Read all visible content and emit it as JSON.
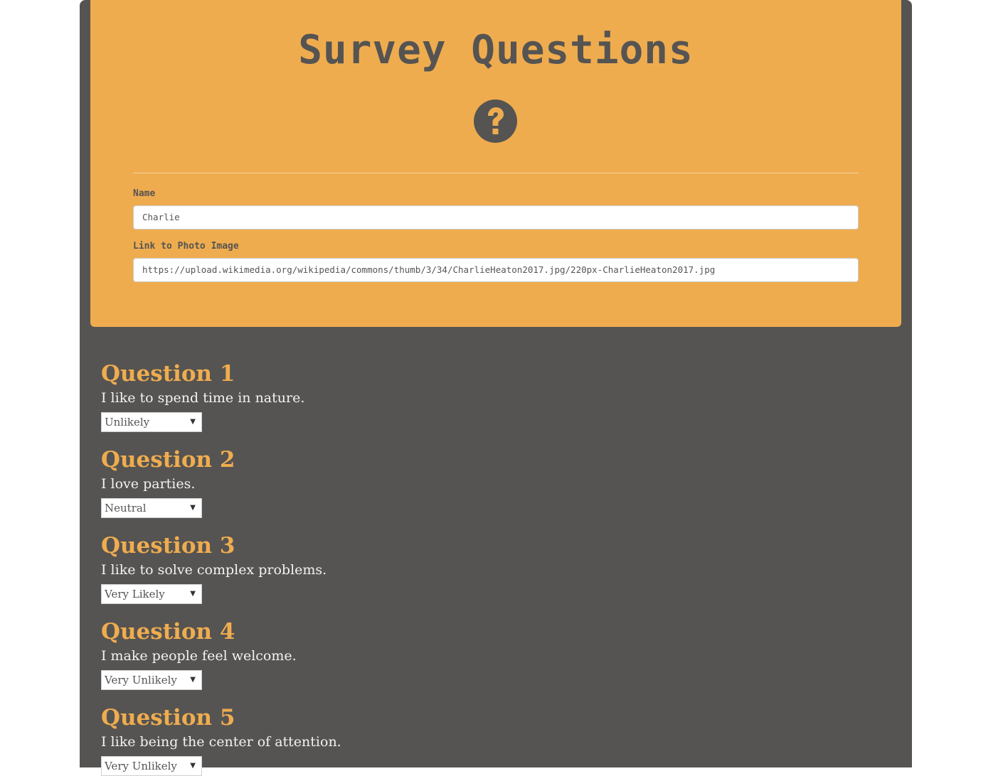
{
  "header": {
    "title": "Survey Questions",
    "icon": "question-circle-icon",
    "accent_color": "#efac4f",
    "dark_color": "#555452"
  },
  "form": {
    "name_label": "Name",
    "name_value": "Charlie",
    "photo_label": "Link to Photo Image",
    "photo_value": "https://upload.wikimedia.org/wikipedia/commons/thumb/3/34/CharlieHeaton2017.jpg/220px-CharlieHeaton2017.jpg"
  },
  "questions": [
    {
      "title": "Question 1",
      "text": "I like to spend time in nature.",
      "answer": "Unlikely"
    },
    {
      "title": "Question 2",
      "text": "I love parties.",
      "answer": "Neutral"
    },
    {
      "title": "Question 3",
      "text": "I like to solve complex problems.",
      "answer": "Very Likely"
    },
    {
      "title": "Question 4",
      "text": "I make people feel welcome.",
      "answer": "Very Unlikely"
    },
    {
      "title": "Question 5",
      "text": "I like being the center of attention.",
      "answer": "Very Unlikely"
    }
  ]
}
